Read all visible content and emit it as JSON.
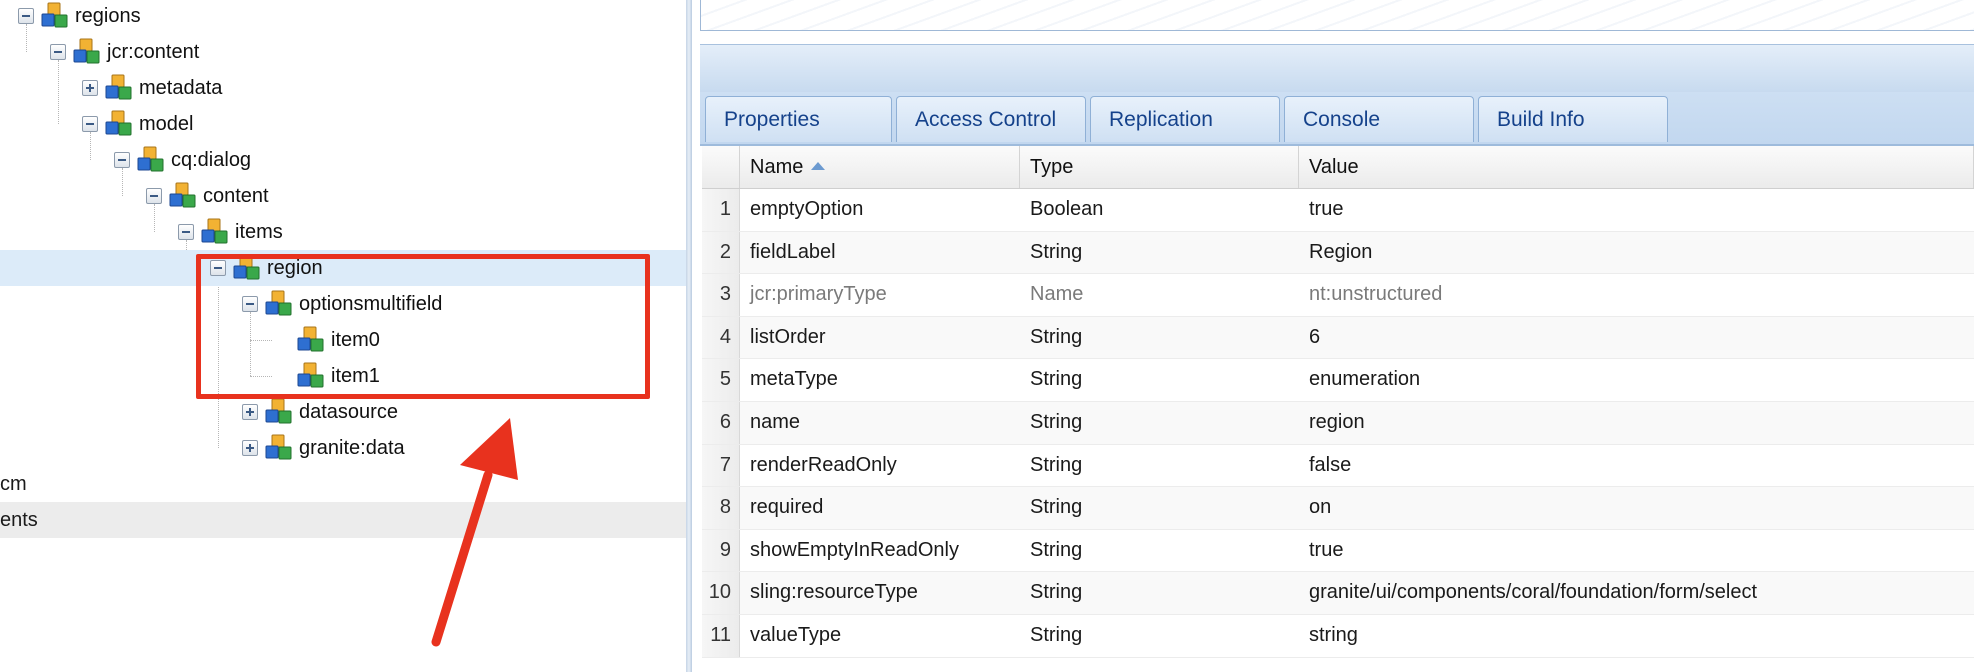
{
  "tree": {
    "nodes": [
      {
        "id": "regions",
        "label": "regions",
        "toggle": "minus"
      },
      {
        "id": "jcr-content",
        "label": "jcr:content",
        "toggle": "minus"
      },
      {
        "id": "metadata",
        "label": "metadata",
        "toggle": "plus"
      },
      {
        "id": "model",
        "label": "model",
        "toggle": "minus"
      },
      {
        "id": "cq-dialog",
        "label": "cq:dialog",
        "toggle": "minus"
      },
      {
        "id": "content",
        "label": "content",
        "toggle": "minus"
      },
      {
        "id": "items",
        "label": "items",
        "toggle": "minus"
      },
      {
        "id": "region",
        "label": "region",
        "toggle": "minus",
        "selected": true
      },
      {
        "id": "optionsmultifield",
        "label": "optionsmultifield",
        "toggle": "minus"
      },
      {
        "id": "item0",
        "label": "item0",
        "toggle": "none"
      },
      {
        "id": "item1",
        "label": "item1",
        "toggle": "none"
      },
      {
        "id": "datasource",
        "label": "datasource",
        "toggle": "plus"
      },
      {
        "id": "granite-data",
        "label": "granite:data",
        "toggle": "plus"
      }
    ],
    "cut_rows": [
      {
        "label": "cm"
      },
      {
        "label": "ents"
      }
    ]
  },
  "tabs": [
    {
      "label": "Properties",
      "active": true
    },
    {
      "label": "Access Control",
      "active": false
    },
    {
      "label": "Replication",
      "active": false
    },
    {
      "label": "Console",
      "active": false
    },
    {
      "label": "Build Info",
      "active": false
    }
  ],
  "grid": {
    "headers": {
      "name": "Name",
      "type": "Type",
      "value": "Value"
    },
    "sorted_column": "name",
    "rows": [
      {
        "n": "1",
        "name": "emptyOption",
        "type": "Boolean",
        "value": "true"
      },
      {
        "n": "2",
        "name": "fieldLabel",
        "type": "String",
        "value": "Region"
      },
      {
        "n": "3",
        "name": "jcr:primaryType",
        "type": "Name",
        "value": "nt:unstructured",
        "dim": true
      },
      {
        "n": "4",
        "name": "listOrder",
        "type": "String",
        "value": "6"
      },
      {
        "n": "5",
        "name": "metaType",
        "type": "String",
        "value": "enumeration"
      },
      {
        "n": "6",
        "name": "name",
        "type": "String",
        "value": "region"
      },
      {
        "n": "7",
        "name": "renderReadOnly",
        "type": "String",
        "value": "false"
      },
      {
        "n": "8",
        "name": "required",
        "type": "String",
        "value": "on"
      },
      {
        "n": "9",
        "name": "showEmptyInReadOnly",
        "type": "String",
        "value": "true"
      },
      {
        "n": "10",
        "name": "sling:resourceType",
        "type": "String",
        "value": "granite/ui/components/coral/foundation/form/select"
      },
      {
        "n": "11",
        "name": "valueType",
        "type": "String",
        "value": "string"
      }
    ]
  },
  "colors": {
    "annotation": "#e8321e",
    "selection": "#dcebf9",
    "tab_text": "#15428b"
  },
  "icons": {
    "tree_node": "node-cubes-icon",
    "sort": "sort-ascending-icon"
  }
}
